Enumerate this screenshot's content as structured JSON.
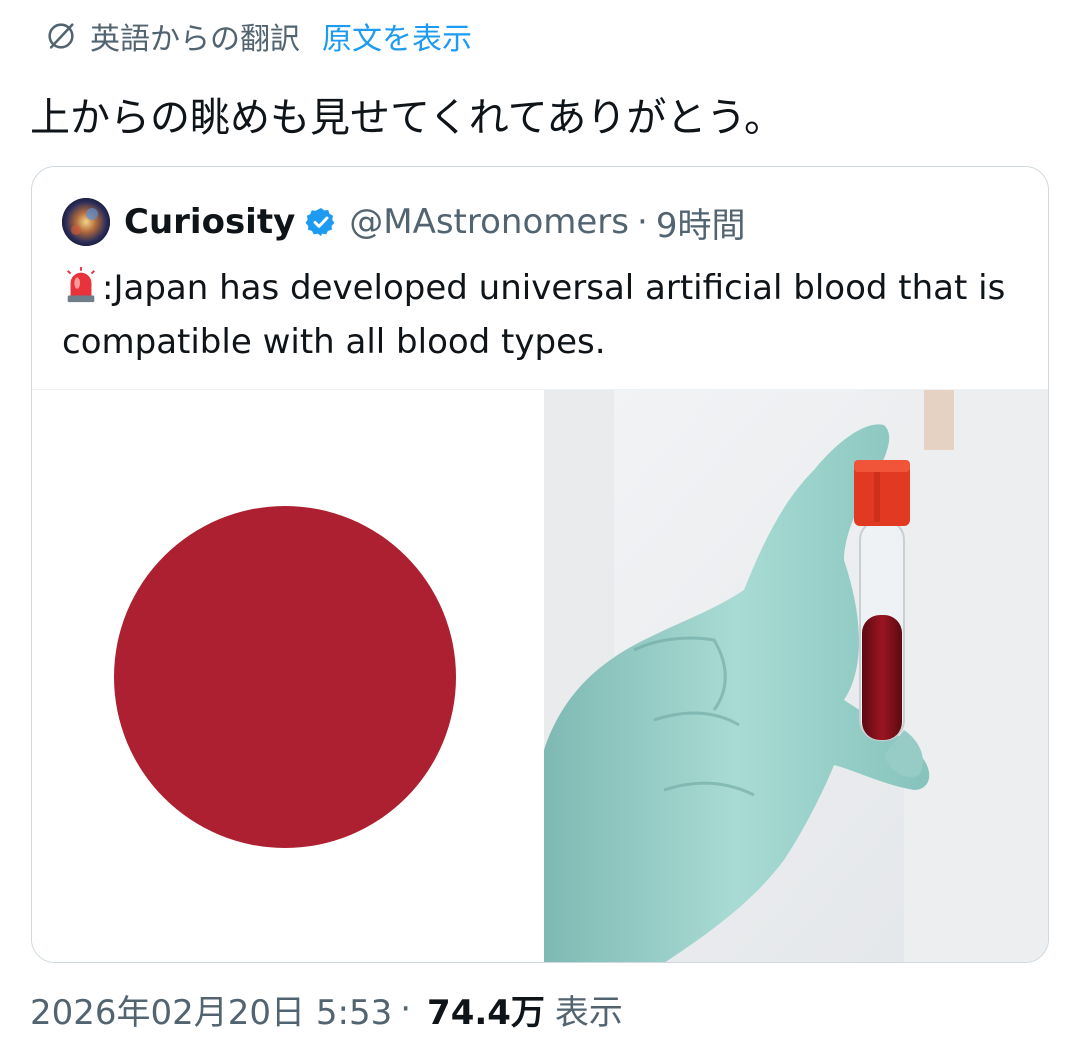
{
  "translation": {
    "label": "英語からの翻訳",
    "show_original": "原文を表示"
  },
  "tweet": {
    "text": "上からの眺めも見せてくれてありがとう。"
  },
  "quote": {
    "display_name": "Curiosity",
    "handle": "@MAstronomers",
    "separator": "·",
    "time": "9時間",
    "body": ":Japan has developed universal artificial blood that is compatible with all blood types."
  },
  "footer": {
    "datetime": "2026年02月20日 5:53",
    "separator": "·",
    "views": "74.4万",
    "views_label": "表示"
  },
  "colors": {
    "accent": "#1d9bf0",
    "muted": "#536471",
    "flag_red": "#ad2031",
    "glove": "#9fd3cc"
  },
  "icons": {
    "translate": "globe-slash-icon",
    "verified": "verified-badge-icon",
    "siren": "police-light-emoji"
  }
}
